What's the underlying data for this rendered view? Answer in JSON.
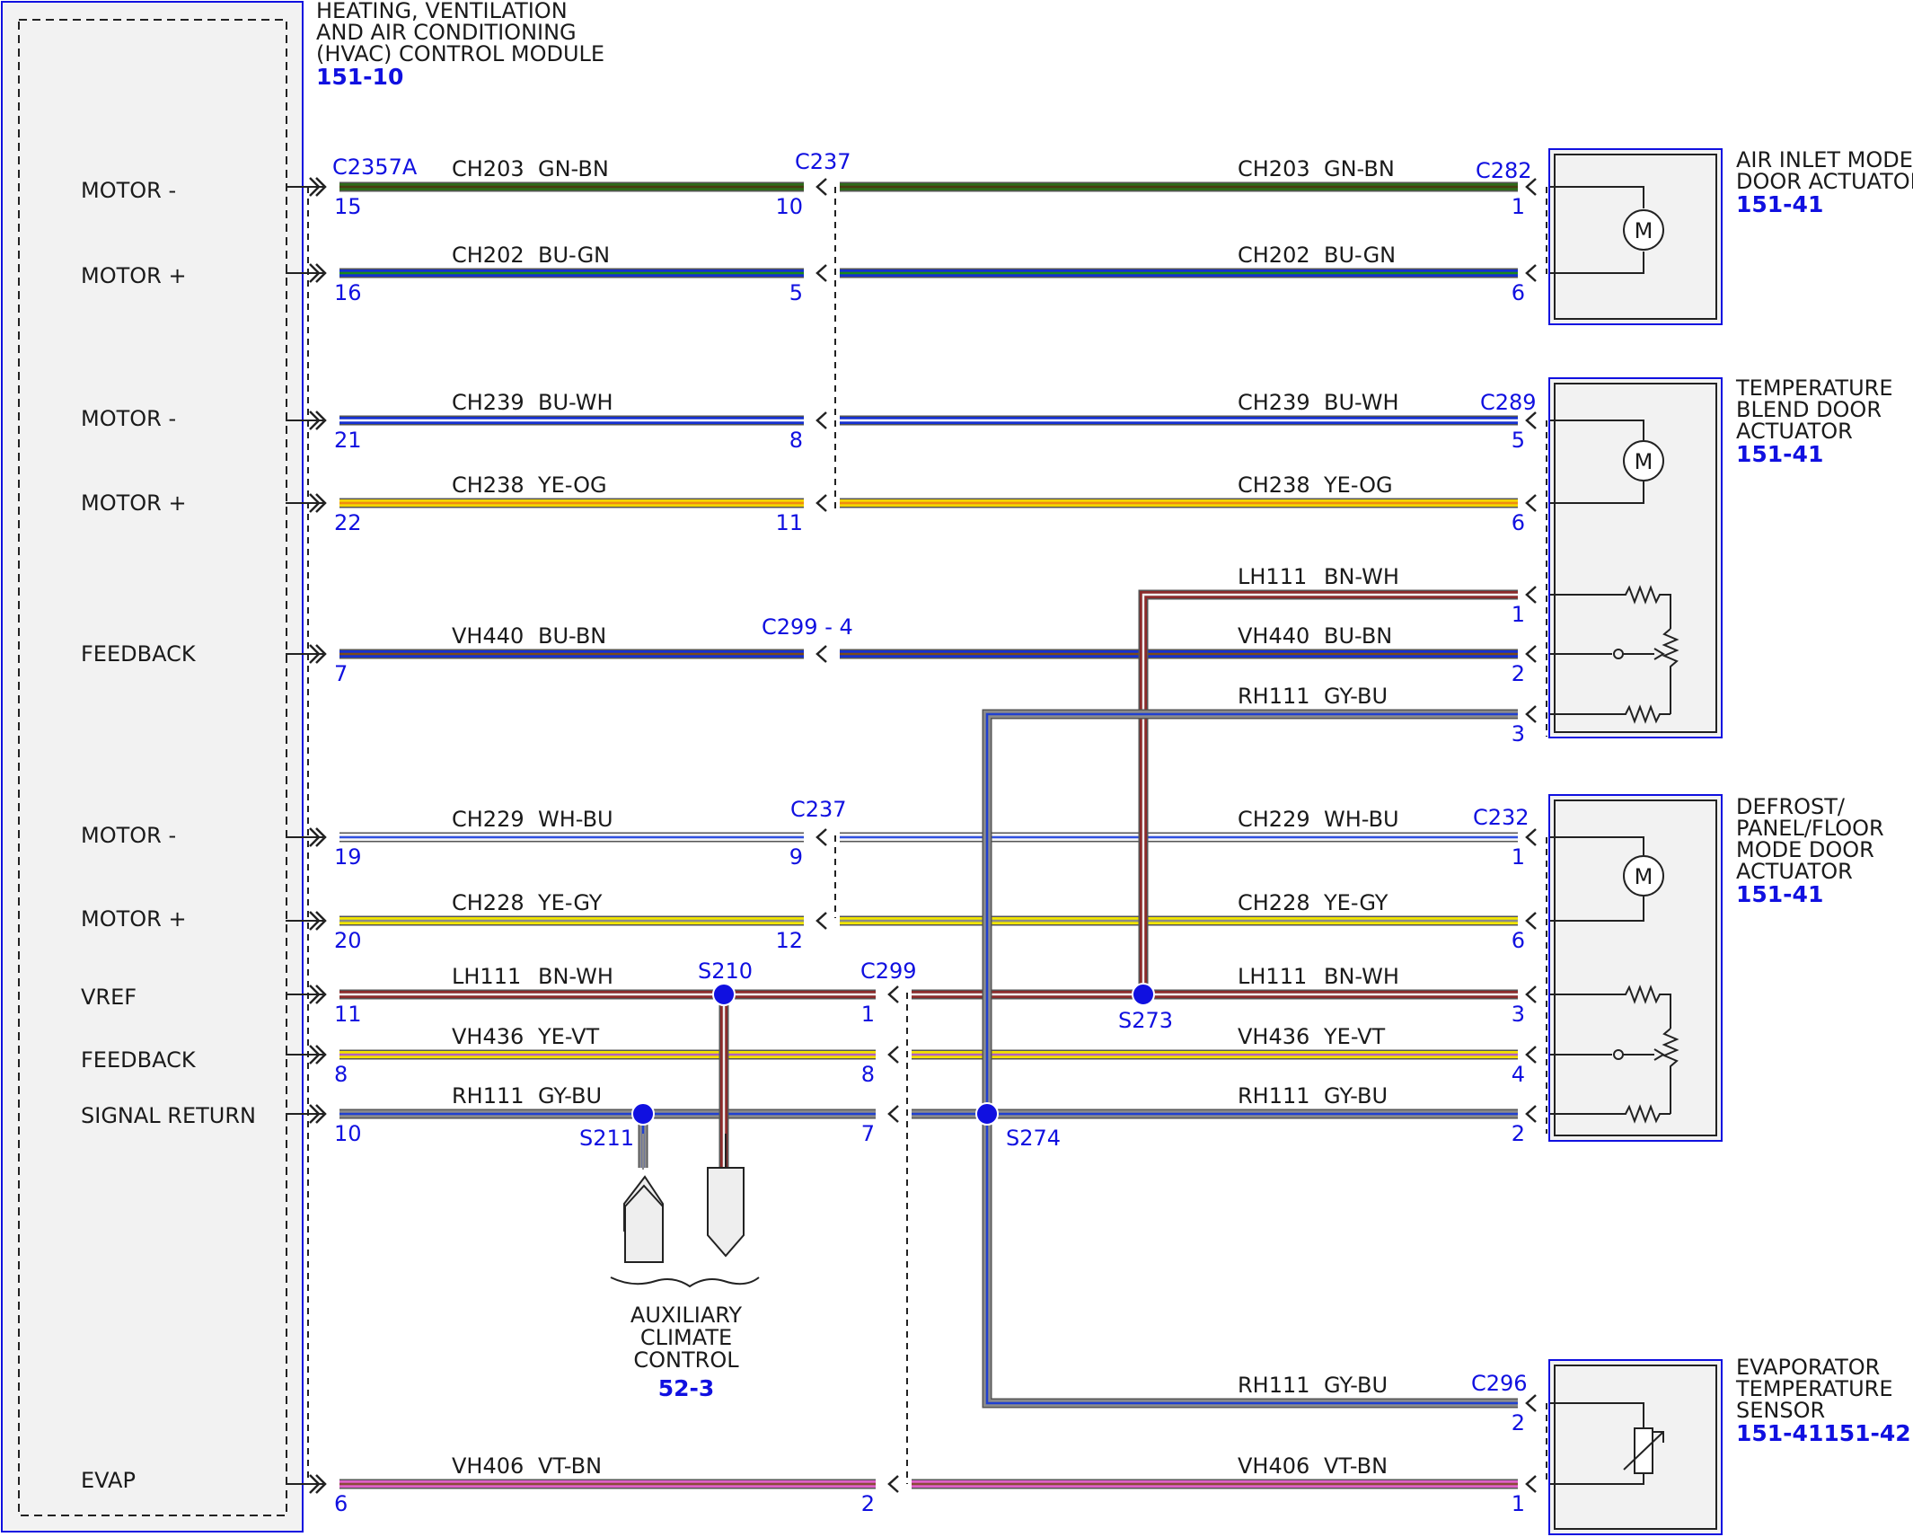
{
  "module": {
    "title_lines": [
      "HEATING, VENTILATION",
      "AND AIR CONDITIONING",
      "(HVAC) CONTROL MODULE"
    ],
    "ref": "151-10",
    "connector": "C2357A"
  },
  "pin_labels": [
    "MOTOR -",
    "MOTOR +",
    "MOTOR -",
    "MOTOR +",
    "FEEDBACK",
    "MOTOR -",
    "MOTOR +",
    "VREF",
    "FEEDBACK",
    "SIGNAL RETURN",
    "EVAP"
  ],
  "wires": [
    {
      "circuit": "CH203",
      "color": "GN-BN",
      "module_pin": "15",
      "mid_pin": "10",
      "end_pin": "1"
    },
    {
      "circuit": "CH202",
      "color": "BU-GN",
      "module_pin": "16",
      "mid_pin": "5",
      "end_pin": "6"
    },
    {
      "circuit": "CH239",
      "color": "BU-WH",
      "module_pin": "21",
      "mid_pin": "8",
      "end_pin": "5"
    },
    {
      "circuit": "CH238",
      "color": "YE-OG",
      "module_pin": "22",
      "mid_pin": "11",
      "end_pin": "6"
    },
    {
      "circuit": "VH440",
      "color": "BU-BN",
      "module_pin": "7",
      "mid_pin": "",
      "end_pin": "2"
    },
    {
      "circuit": "CH229",
      "color": "WH-BU",
      "module_pin": "19",
      "mid_pin": "9",
      "end_pin": "1"
    },
    {
      "circuit": "CH228",
      "color": "YE-GY",
      "module_pin": "20",
      "mid_pin": "12",
      "end_pin": "6"
    },
    {
      "circuit": "LH111",
      "color": "BN-WH",
      "module_pin": "11",
      "mid_pin": "1",
      "end_pin": "3"
    },
    {
      "circuit": "VH436",
      "color": "YE-VT",
      "module_pin": "8",
      "mid_pin": "8",
      "end_pin": "4"
    },
    {
      "circuit": "RH111",
      "color": "GY-BU",
      "module_pin": "10",
      "mid_pin": "7",
      "end_pin": "2"
    },
    {
      "circuit": "VH406",
      "color": "VT-BN",
      "module_pin": "6",
      "mid_pin": "2",
      "end_pin": "1"
    }
  ],
  "branches": [
    {
      "circuit": "LH111",
      "color": "BN-WH",
      "end_pin": "1"
    },
    {
      "circuit": "RH111",
      "color": "GY-BU",
      "end_pin": "3"
    },
    {
      "circuit": "RH111",
      "color": "GY-BU",
      "end_pin": "2"
    }
  ],
  "inline_connectors": {
    "c237_top": "C237",
    "c237_bottom": "C237",
    "c299_upper": "C299 - 4",
    "c299_lower": "C299"
  },
  "splices": {
    "s210": "S210",
    "s211": "S211",
    "s273": "S273",
    "s274": "S274"
  },
  "components": [
    {
      "name_lines": [
        "AIR INLET MODE",
        "DOOR ACTUATOR"
      ],
      "ref": "151-41",
      "connector": "C282"
    },
    {
      "name_lines": [
        "TEMPERATURE",
        "BLEND DOOR",
        "ACTUATOR"
      ],
      "ref": "151-41",
      "connector": "C289"
    },
    {
      "name_lines": [
        "DEFROST/",
        "PANEL/FLOOR",
        "MODE DOOR",
        "ACTUATOR"
      ],
      "ref": "151-41",
      "connector": "C232"
    },
    {
      "name_lines": [
        "EVAPORATOR",
        "TEMPERATURE",
        "SENSOR"
      ],
      "ref": "151-41151-42",
      "connector": "C296"
    }
  ],
  "auxiliary": {
    "name_lines": [
      "AUXILIARY",
      "CLIMATE",
      "CONTROL"
    ],
    "ref": "52-3"
  },
  "motor_symbol": "M",
  "colors": {
    "GN-BN": [
      "#2e6b1a",
      "#4a3a10"
    ],
    "BU-GN": [
      "#1530d0",
      "#1a8a1a"
    ],
    "BU-WH": [
      "#1530d0",
      "#ffffff"
    ],
    "YE-OG": [
      "#f2d600",
      "#f08a10"
    ],
    "BU-BN": [
      "#1530d0",
      "#7a4a1a"
    ],
    "WH-BU": [
      "#f4f4f4",
      "#3050e0"
    ],
    "YE-GY": [
      "#f2e600",
      "#8a8a8a"
    ],
    "BN-WH": [
      "#8b2a2a",
      "#f0f0f0"
    ],
    "YE-VT": [
      "#f2e000",
      "#b060c0"
    ],
    "GY-BU": [
      "#8a8a8a",
      "#2040d0"
    ],
    "VT-BN": [
      "#e060c8",
      "#8a4a3a"
    ],
    "accent": "#1010e0"
  }
}
